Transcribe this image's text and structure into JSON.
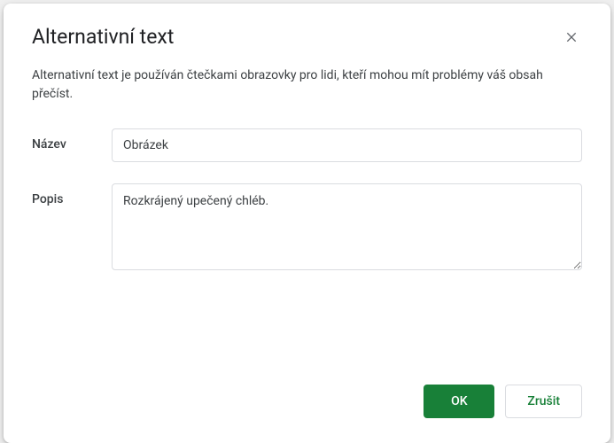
{
  "dialog": {
    "title": "Alternativní text",
    "description": "Alternativní text je používán čtečkami obrazovky pro lidi, kteří mohou mít problémy váš obsah přečíst.",
    "fields": {
      "title": {
        "label": "Název",
        "value": "Obrázek"
      },
      "description": {
        "label": "Popis",
        "value": "Rozkrájený upečený chléb."
      }
    },
    "buttons": {
      "ok": "OK",
      "cancel": "Zrušit"
    }
  }
}
